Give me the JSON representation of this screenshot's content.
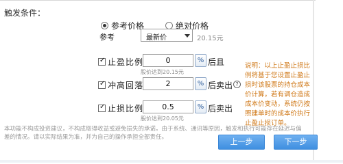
{
  "section_title": "触发条件：",
  "price_mode": {
    "options": [
      "参考价格",
      "绝对价格"
    ],
    "selected": "参考价格"
  },
  "reference": {
    "label": "参考",
    "select_value": "最新价",
    "current_price": "20.15元"
  },
  "rows": [
    {
      "label": "止盈比例",
      "checked": true,
      "value": "0",
      "pct_label": "%",
      "suffix": "后且",
      "hint": "股价达到20.15元"
    },
    {
      "label": "冲高回落",
      "checked": true,
      "value": "2",
      "pct_label": "%",
      "suffix": "后卖出",
      "hint": ""
    },
    {
      "label": "止损比例",
      "checked": true,
      "value": "0.5",
      "pct_label": "%",
      "suffix": "后卖出",
      "hint": "股价达到20.05元"
    }
  ],
  "help_icon_text": "?",
  "note": "说明：以上止盈止损比例将基于您设置止盈止损时该股票的持仓成本价计算，若有调仓造成成本价变动，系统仍按照建单时的成本价执行止盈止损订单。",
  "disclaimer": "本功能不构成投资建议，不构成取得收益或避免损失的承诺。由于系统、通讯等原因，触发和执行可能存在延迟与偏差的情况。请以实际结果为准，并为自己的操作承担全部责任。",
  "buttons": {
    "prev": "上一步",
    "next": "下一步"
  },
  "colors": {
    "accent": "#3f8fe0",
    "note": "#d07a1a"
  }
}
